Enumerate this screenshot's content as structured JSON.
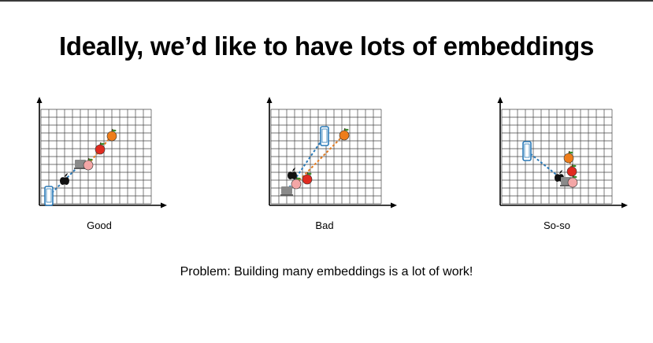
{
  "slide": {
    "title": "Ideally, we’d like to have lots of embeddings",
    "problem": "Problem: Building many embeddings is a lot of work!"
  },
  "colors": {
    "phone_line": "#2a7ab8",
    "orange_line": "#e07b22",
    "phone": "#2a7ab8",
    "apple_logo": "#111111",
    "mac": "#8a8a8a",
    "red_apple": "#e02b20",
    "pink_apple": "#f3a6a6",
    "orange": "#ee7d1b",
    "grid": "#444444"
  },
  "panels": [
    {
      "caption": "Good",
      "items": [
        {
          "icon": "phone-icon",
          "x": 1,
          "y": 1
        },
        {
          "icon": "apple-logo-icon",
          "x": 3,
          "y": 3
        },
        {
          "icon": "mac-icon",
          "x": 5,
          "y": 5
        },
        {
          "icon": "pink-apple-icon",
          "x": 6,
          "y": 5
        },
        {
          "icon": "red-apple-icon",
          "x": 7.5,
          "y": 7
        },
        {
          "icon": "orange-icon",
          "x": 9,
          "y": 8.7
        }
      ],
      "links": [
        {
          "from": 0,
          "to": 2,
          "color": "phone_line"
        },
        {
          "from": 3,
          "to": 5,
          "color": "orange_line"
        }
      ]
    },
    {
      "caption": "Bad",
      "items": [
        {
          "icon": "mac-icon",
          "x": 2,
          "y": 1.6
        },
        {
          "icon": "apple-logo-icon",
          "x": 2.7,
          "y": 3.7
        },
        {
          "icon": "pink-apple-icon",
          "x": 3.2,
          "y": 2.6
        },
        {
          "icon": "red-apple-icon",
          "x": 4.6,
          "y": 3.2
        },
        {
          "icon": "phone-icon",
          "x": 6.8,
          "y": 8.6
        },
        {
          "icon": "orange-icon",
          "x": 9.3,
          "y": 8.8
        }
      ],
      "links": [
        {
          "from": 0,
          "to": 4,
          "color": "phone_line"
        },
        {
          "from": 2,
          "to": 5,
          "color": "orange_line"
        }
      ]
    },
    {
      "caption": "So-so",
      "items": [
        {
          "icon": "phone-icon",
          "x": 3.2,
          "y": 6.7
        },
        {
          "icon": "orange-icon",
          "x": 8.5,
          "y": 5.9
        },
        {
          "icon": "red-apple-icon",
          "x": 8.9,
          "y": 4.2
        },
        {
          "icon": "apple-logo-icon",
          "x": 7.3,
          "y": 3.4
        },
        {
          "icon": "mac-icon",
          "x": 8.2,
          "y": 2.8
        },
        {
          "icon": "pink-apple-icon",
          "x": 9.0,
          "y": 2.8
        }
      ],
      "links": [
        {
          "from": 0,
          "to": 3,
          "color": "phone_line"
        },
        {
          "from": 1,
          "to": 2,
          "color": "orange_line"
        }
      ]
    }
  ]
}
